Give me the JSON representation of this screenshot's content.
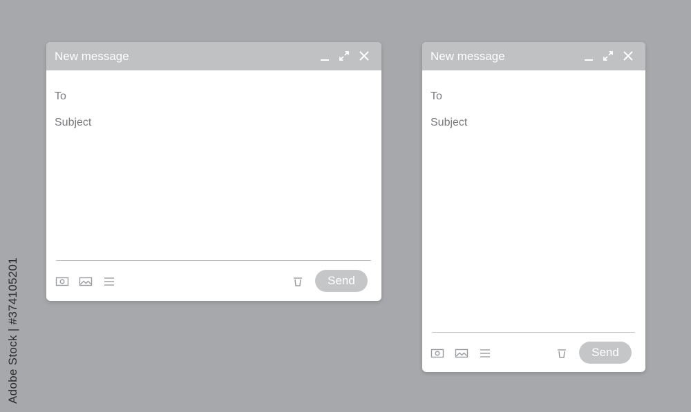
{
  "colors": {
    "background": "#a7a8ab",
    "titlebar": "#c0c1c3",
    "window": "#ffffff",
    "field_text": "#77787b",
    "send_button": "#c5c6c8",
    "icon": "#9a9b9e"
  },
  "windows": [
    {
      "title": "New message",
      "to_label": "To",
      "subject_label": "Subject",
      "send_label": "Send",
      "controls": [
        "minimize-icon",
        "expand-icon",
        "close-icon"
      ],
      "toolbar_icons": [
        "camera-icon",
        "image-icon",
        "list-icon",
        "trash-icon"
      ]
    },
    {
      "title": "New message",
      "to_label": "To",
      "subject_label": "Subject",
      "send_label": "Send",
      "controls": [
        "minimize-icon",
        "expand-icon",
        "close-icon"
      ],
      "toolbar_icons": [
        "camera-icon",
        "image-icon",
        "list-icon",
        "trash-icon"
      ]
    }
  ],
  "watermark": {
    "side_text": "Adobe Stock | #374105201"
  }
}
